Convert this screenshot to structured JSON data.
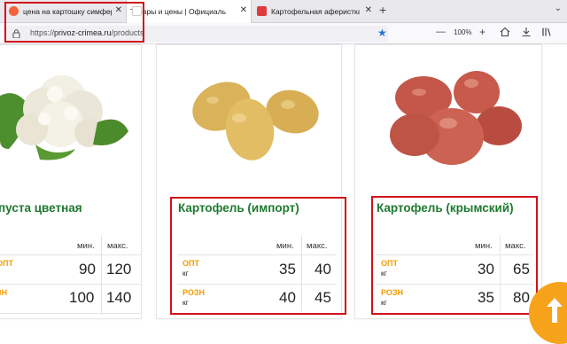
{
  "tabs": [
    {
      "title": "цена на картошку симферопо",
      "favicon_color": "#f4623a"
    },
    {
      "title": "Товары и цены | Официальный са",
      "favicon_color": "#ffffff"
    },
    {
      "title": "Картофельная аферистка ⚡ «",
      "favicon_color": "#e03a3e"
    }
  ],
  "address": {
    "scheme": "https://",
    "host": "privoz-crimea.ru",
    "path": "/products"
  },
  "zoom": "100%",
  "products": [
    {
      "name": "пуста цветная",
      "headers": {
        "min": "мин.",
        "max": "макс."
      },
      "rows": [
        {
          "label": "ОПТ",
          "unit": "кг",
          "min": "90",
          "max": "120"
        },
        {
          "label": "ЗН",
          "unit": "",
          "min": "100",
          "max": "140"
        }
      ]
    },
    {
      "name": "Картофель (импорт)",
      "headers": {
        "min": "мин.",
        "max": "макс."
      },
      "rows": [
        {
          "label": "ОПТ",
          "unit": "кг",
          "min": "35",
          "max": "40"
        },
        {
          "label": "РОЗН",
          "unit": "кг",
          "min": "40",
          "max": "45"
        }
      ]
    },
    {
      "name": "Картофель (крымский)",
      "headers": {
        "min": "мин.",
        "max": "макс."
      },
      "rows": [
        {
          "label": "ОПТ",
          "unit": "кг",
          "min": "30",
          "max": "65"
        },
        {
          "label": "РОЗН",
          "unit": "кг",
          "min": "35",
          "max": "80"
        }
      ]
    }
  ],
  "colors": {
    "accent_green": "#1f7a30",
    "label_orange": "#f39c00",
    "highlight_red": "#d0131b",
    "fab_orange": "#f6a21b"
  },
  "icons": [
    "lock-icon",
    "bookmark-star-icon",
    "home-icon",
    "download-icon",
    "library-icon",
    "close-icon",
    "scroll-up-arrow-icon"
  ]
}
